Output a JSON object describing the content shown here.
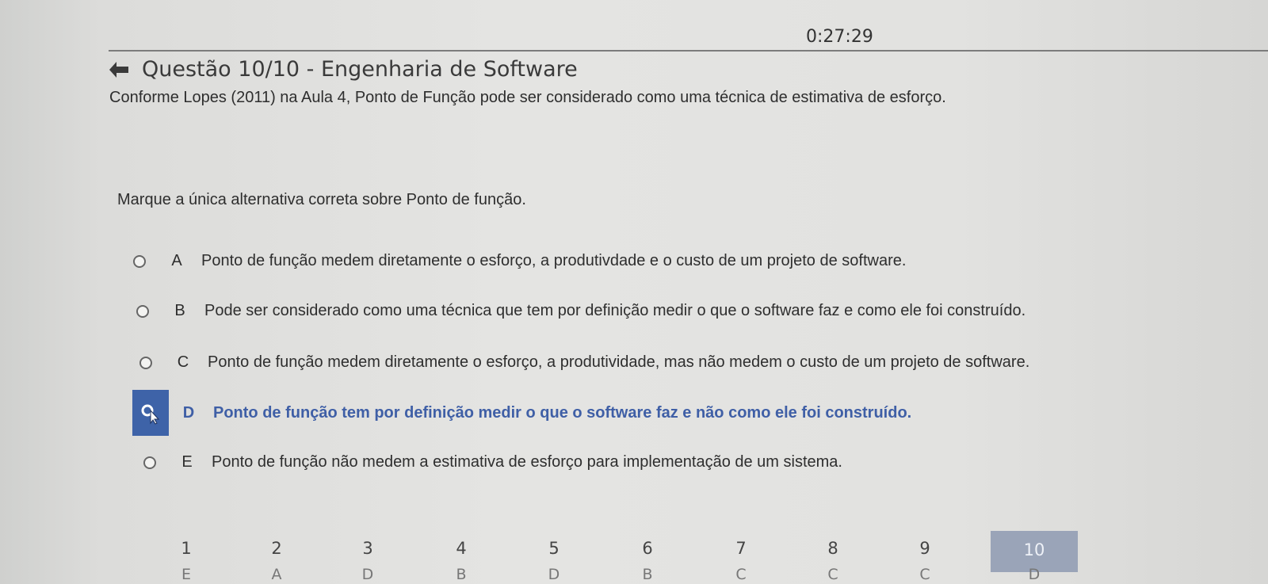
{
  "timer": "0:27:29",
  "question": {
    "title": "Questão 10/10 - Engenharia de Software",
    "statement": "Conforme Lopes (2011) na Aula 4, Ponto de Função pode ser considerado como uma técnica de estimativa de esforço.",
    "instruction": "Marque a única alternativa correta sobre Ponto de função."
  },
  "options": [
    {
      "letter": "A",
      "text": "Ponto de função medem diretamente o esforço, a produtivdade e o custo de um projeto de software.",
      "selected": false
    },
    {
      "letter": "B",
      "text": "Pode ser considerado como uma técnica que tem por definição medir o que o software faz e como ele foi construído.",
      "selected": false
    },
    {
      "letter": "C",
      "text": "Ponto de função medem diretamente o esforço, a produtividade, mas não medem o custo de um projeto de software.",
      "selected": false
    },
    {
      "letter": "D",
      "text": "Ponto de função tem por definição medir o que o software faz e não como ele foi construído.",
      "selected": true
    },
    {
      "letter": "E",
      "text": "Ponto de função não medem a estimativa de esforço para implementação de um sistema.",
      "selected": false
    }
  ],
  "nav": {
    "numbers": [
      "1",
      "2",
      "3",
      "4",
      "5",
      "6",
      "7",
      "8",
      "9",
      "10"
    ],
    "answers": [
      "E",
      "A",
      "D",
      "B",
      "D",
      "B",
      "C",
      "C",
      "C",
      "D"
    ],
    "active_index": 9
  },
  "colors": {
    "selected_box": "#3e63a8",
    "selected_text": "#3f5fa6",
    "nav_active": "#9aa4b8"
  }
}
